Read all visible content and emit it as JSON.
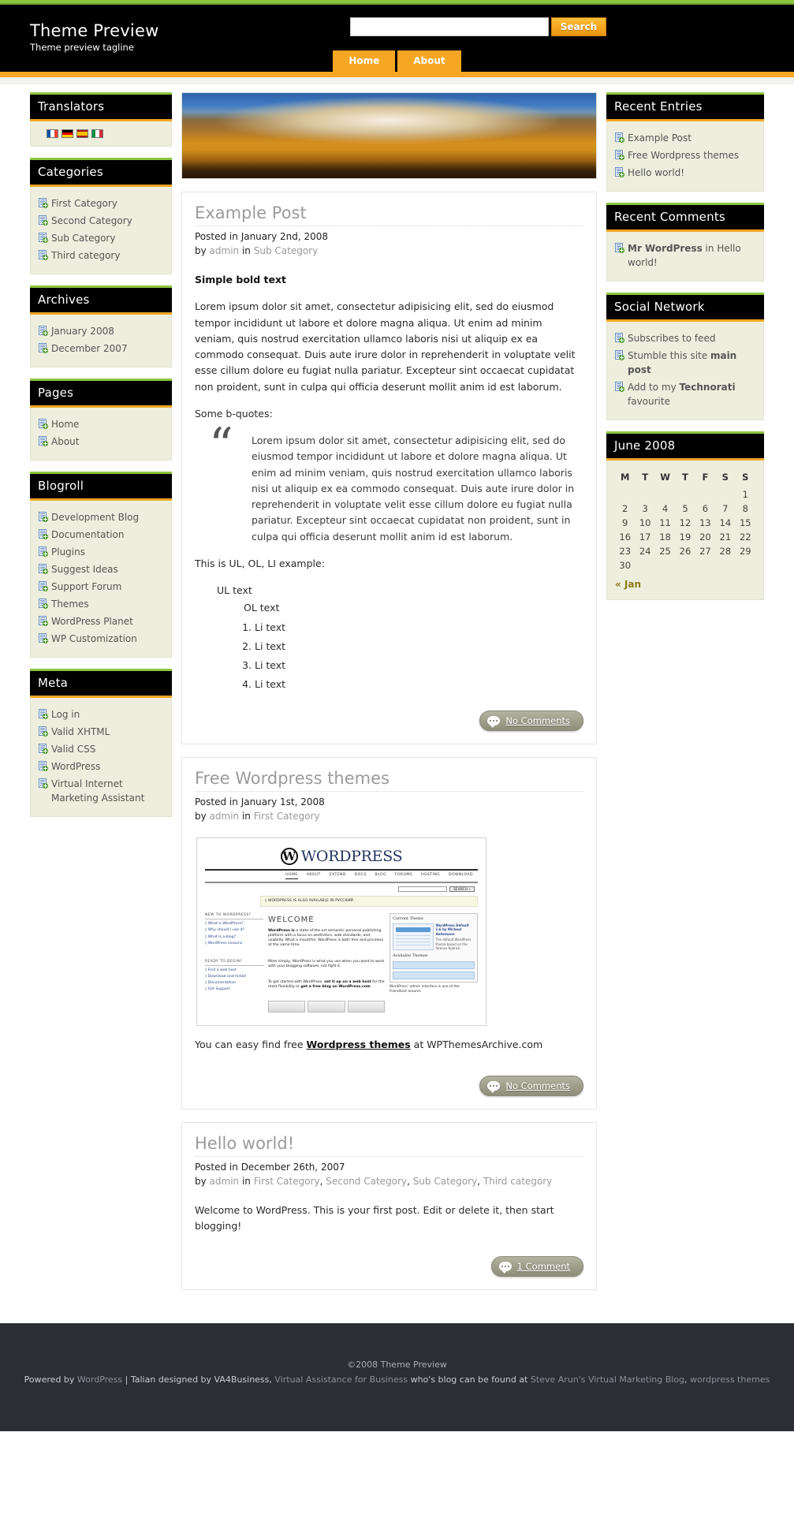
{
  "header": {
    "site_title": "Theme Preview",
    "tagline": "Theme preview tagline",
    "search_placeholder": "",
    "search_value": "",
    "search_button": "Search",
    "nav": [
      {
        "label": "Home"
      },
      {
        "label": "About"
      }
    ]
  },
  "accent": {
    "green": "#8cc63f",
    "orange": "#f5a623",
    "black": "#000000",
    "widget_bg": "#edeedd",
    "footer_bg": "#2b2e35"
  },
  "sidebar_left": [
    {
      "title": "Translators",
      "type": "flags",
      "flags": [
        {
          "name": "flag-france",
          "colors": [
            "#0055a4",
            "#ffffff",
            "#ef4135"
          ]
        },
        {
          "name": "flag-germany",
          "colors": [
            "#000000",
            "#dd0000",
            "#ffce00"
          ],
          "horizontal": true
        },
        {
          "name": "flag-spain",
          "colors": [
            "#aa151b",
            "#f1bf00",
            "#aa151b"
          ],
          "horizontal": true
        },
        {
          "name": "flag-italy",
          "colors": [
            "#009246",
            "#ffffff",
            "#ce2b37"
          ]
        }
      ]
    },
    {
      "title": "Categories",
      "type": "links",
      "items": [
        "First Category",
        "Second Category",
        "Sub Category",
        "Third category"
      ]
    },
    {
      "title": "Archives",
      "type": "links",
      "items": [
        "January 2008",
        "December 2007"
      ]
    },
    {
      "title": "Pages",
      "type": "links",
      "items": [
        "Home",
        "About"
      ]
    },
    {
      "title": "Blogroll",
      "type": "links",
      "items": [
        "Development Blog",
        "Documentation",
        "Plugins",
        "Suggest Ideas",
        "Support Forum",
        "Themes",
        "WordPress Planet",
        "WP Customization"
      ]
    },
    {
      "title": "Meta",
      "type": "links",
      "items": [
        "Log in",
        "Valid XHTML",
        "Valid CSS",
        "WordPress",
        "Virtual Internet Marketing Assistant"
      ]
    }
  ],
  "sidebar_right": {
    "recent_entries": {
      "title": "Recent Entries",
      "items": [
        "Example Post",
        "Free Wordpress themes",
        "Hello world!"
      ]
    },
    "recent_comments": {
      "title": "Recent Comments",
      "items": [
        {
          "author": "Mr WordPress",
          "middle": " in ",
          "post": "Hello world!"
        }
      ]
    },
    "social_network": {
      "title": "Social Network",
      "items": [
        {
          "pre": "Subscribes to feed",
          "strong": "",
          "post": ""
        },
        {
          "pre": "Stumble this site ",
          "strong": "main post",
          "post": ""
        },
        {
          "pre": "Add to my ",
          "strong": "Technorati",
          "post": " favourite"
        }
      ]
    },
    "calendar": {
      "title": "June 2008",
      "weekdays": [
        "M",
        "T",
        "W",
        "T",
        "F",
        "S",
        "S"
      ],
      "weeks": [
        [
          "",
          "",
          "",
          "",
          "",
          "",
          "1"
        ],
        [
          "2",
          "3",
          "4",
          "5",
          "6",
          "7",
          "8"
        ],
        [
          "9",
          "10",
          "11",
          "12",
          "13",
          "14",
          "15"
        ],
        [
          "16",
          "17",
          "18",
          "19",
          "20",
          "21",
          "22"
        ],
        [
          "23",
          "24",
          "25",
          "26",
          "27",
          "28",
          "29"
        ],
        [
          "30",
          "",
          "",
          "",
          "",
          "",
          ""
        ]
      ],
      "prev_label": "« Jan"
    }
  },
  "posts": [
    {
      "title": "Example Post",
      "posted_prefix": "Posted in ",
      "date": "January 2nd, 2008",
      "by_prefix": "by ",
      "author": "admin",
      "in_word": " in ",
      "categories": [
        "Sub Category"
      ],
      "bold_heading": "Simple bold text",
      "paragraph": "Lorem ipsum dolor sit amet, consectetur adipisicing elit, sed do eiusmod tempor incididunt ut labore et dolore magna aliqua. Ut enim ad minim veniam, quis nostrud exercitation ullamco laboris nisi ut aliquip ex ea commodo consequat. Duis aute irure dolor in reprehenderit in voluptate velit esse cillum dolore eu fugiat nulla pariatur. Excepteur sint occaecat cupidatat non proident, sunt in culpa qui officia deserunt mollit anim id est laborum.",
      "quote_intro": "Some b-quotes:",
      "quote": "Lorem ipsum dolor sit amet, consectetur adipisicing elit, sed do eiusmod tempor incididunt ut labore et dolore magna aliqua. Ut enim ad minim veniam, quis nostrud exercitation ullamco laboris nisi ut aliquip ex ea commodo consequat. Duis aute irure dolor in reprehenderit in voluptate velit esse cillum dolore eu fugiat nulla pariatur. Excepteur sint occaecat cupidatat non proident, sunt in culpa qui officia deserunt mollit anim id est laborum.",
      "list_intro": "This is UL, OL, LI example:",
      "ul_text": "UL text",
      "ol_text": "OL text",
      "ol_items": [
        "Li text",
        "Li text",
        "Li text",
        "Li text"
      ],
      "comments_label": "No Comments"
    },
    {
      "title": "Free Wordpress themes",
      "posted_prefix": "Posted in ",
      "date": "January 1st, 2008",
      "by_prefix": "by ",
      "author": "admin",
      "in_word": " in ",
      "categories": [
        "First Category"
      ],
      "body_pre": "You can easy find free ",
      "body_link": "Wordpress themes",
      "body_post": " at WPThemesArchive.com",
      "comments_label": "No Comments"
    },
    {
      "title": "Hello world!",
      "posted_prefix": "Posted in ",
      "date": "December 26th, 2007",
      "by_prefix": "by ",
      "author": "admin",
      "in_word": " in ",
      "categories": [
        "First Category",
        "Second Category",
        "Sub Category",
        "Third category"
      ],
      "body": "Welcome to WordPress. This is your first post. Edit or delete it, then start blogging!",
      "comments_label": "1 Comment"
    }
  ],
  "wp_screenshot": {
    "logo_mark": "W",
    "logo_text": "WORDPRESS",
    "nav": [
      "HOME",
      "ABOUT",
      "EXTEND",
      "DOCS",
      "BLOG",
      "FORUMS",
      "HOSTING",
      "DOWNLOAD"
    ],
    "search_button": "SEARCH »",
    "notice": "◊ WORDPRESS IS ALSO AVAILABLE IN РУССКИЙ.",
    "left_head_1": "NEW TO WORDPRESS?",
    "left_links_1": [
      "◊ What is WordPress?",
      "◊ Why should I use it?",
      "◊ What is a blog?",
      "◊ WordPress Lessons"
    ],
    "left_head_2": "READY TO BEGIN?",
    "left_links_2": [
      "◊ Find a web host",
      "◊ Download and Install",
      "◊ Documentation",
      "◊ Get Support"
    ],
    "welcome": "WELCOME",
    "p1_pre": "WordPress is",
    "p1": " a state-of-the-art semantic personal publishing platform with a focus on aesthetics, web standards, and usability. What a mouthful. WordPress is both free and priceless at the same time.",
    "p2": "More simply, WordPress is what you use when you want to work with your blogging software, not fight it.",
    "p3_pre": "To get started with WordPress, ",
    "p3_b1": "set it up on a web host",
    "p3_mid": " for the most flexibility or ",
    "p3_b2": "get a free blog on WordPress.com",
    "p3_end": ".",
    "panel_title": "Current Theme",
    "panel_sub": "WordPress Default 1.6 by Michael Heilemann",
    "panel_note": "The default WordPress theme based on the famous Kubrick.",
    "panel_available": "Available Themes",
    "caption": "WordPress' admin interface is one of the friendliest around."
  },
  "footer": {
    "copyright": "©2008 Theme Preview",
    "line2": [
      {
        "text": "Powered by ",
        "link": false
      },
      {
        "text": "WordPress",
        "link": true
      },
      {
        "text": " | Talian designed by ",
        "link": false
      },
      {
        "text": "VA4Business,",
        "link": false
      },
      {
        "text": " Virtual Assistance for Business",
        "link": true
      },
      {
        "text": " who's blog can be found at ",
        "link": false
      },
      {
        "text": "Steve Arun's Virtual Marketing Blog",
        "link": true
      },
      {
        "text": ", ",
        "link": false
      },
      {
        "text": "wordpress themes",
        "link": true
      }
    ]
  }
}
